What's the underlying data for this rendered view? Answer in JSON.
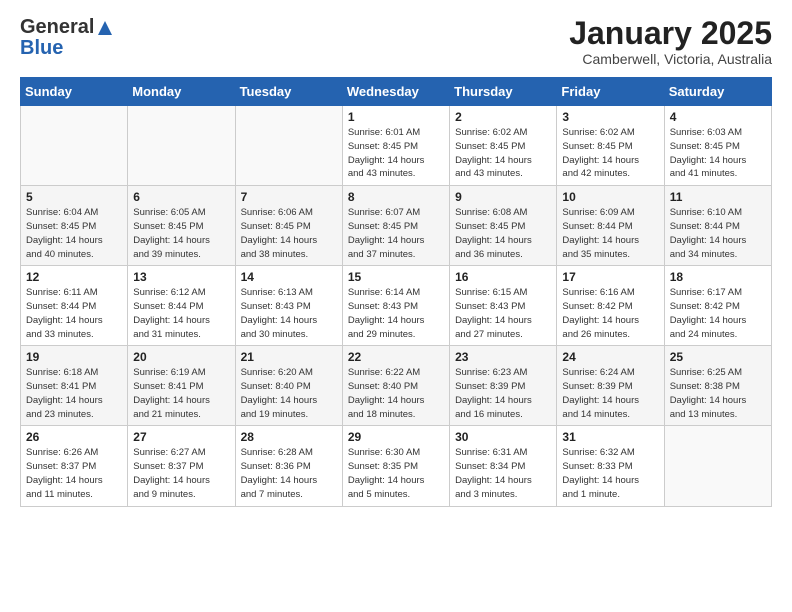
{
  "header": {
    "logo_general": "General",
    "logo_blue": "Blue",
    "month_title": "January 2025",
    "location": "Camberwell, Victoria, Australia"
  },
  "weekdays": [
    "Sunday",
    "Monday",
    "Tuesday",
    "Wednesday",
    "Thursday",
    "Friday",
    "Saturday"
  ],
  "weeks": [
    [
      {
        "num": "",
        "info": ""
      },
      {
        "num": "",
        "info": ""
      },
      {
        "num": "",
        "info": ""
      },
      {
        "num": "1",
        "info": "Sunrise: 6:01 AM\nSunset: 8:45 PM\nDaylight: 14 hours\nand 43 minutes."
      },
      {
        "num": "2",
        "info": "Sunrise: 6:02 AM\nSunset: 8:45 PM\nDaylight: 14 hours\nand 43 minutes."
      },
      {
        "num": "3",
        "info": "Sunrise: 6:02 AM\nSunset: 8:45 PM\nDaylight: 14 hours\nand 42 minutes."
      },
      {
        "num": "4",
        "info": "Sunrise: 6:03 AM\nSunset: 8:45 PM\nDaylight: 14 hours\nand 41 minutes."
      }
    ],
    [
      {
        "num": "5",
        "info": "Sunrise: 6:04 AM\nSunset: 8:45 PM\nDaylight: 14 hours\nand 40 minutes."
      },
      {
        "num": "6",
        "info": "Sunrise: 6:05 AM\nSunset: 8:45 PM\nDaylight: 14 hours\nand 39 minutes."
      },
      {
        "num": "7",
        "info": "Sunrise: 6:06 AM\nSunset: 8:45 PM\nDaylight: 14 hours\nand 38 minutes."
      },
      {
        "num": "8",
        "info": "Sunrise: 6:07 AM\nSunset: 8:45 PM\nDaylight: 14 hours\nand 37 minutes."
      },
      {
        "num": "9",
        "info": "Sunrise: 6:08 AM\nSunset: 8:45 PM\nDaylight: 14 hours\nand 36 minutes."
      },
      {
        "num": "10",
        "info": "Sunrise: 6:09 AM\nSunset: 8:44 PM\nDaylight: 14 hours\nand 35 minutes."
      },
      {
        "num": "11",
        "info": "Sunrise: 6:10 AM\nSunset: 8:44 PM\nDaylight: 14 hours\nand 34 minutes."
      }
    ],
    [
      {
        "num": "12",
        "info": "Sunrise: 6:11 AM\nSunset: 8:44 PM\nDaylight: 14 hours\nand 33 minutes."
      },
      {
        "num": "13",
        "info": "Sunrise: 6:12 AM\nSunset: 8:44 PM\nDaylight: 14 hours\nand 31 minutes."
      },
      {
        "num": "14",
        "info": "Sunrise: 6:13 AM\nSunset: 8:43 PM\nDaylight: 14 hours\nand 30 minutes."
      },
      {
        "num": "15",
        "info": "Sunrise: 6:14 AM\nSunset: 8:43 PM\nDaylight: 14 hours\nand 29 minutes."
      },
      {
        "num": "16",
        "info": "Sunrise: 6:15 AM\nSunset: 8:43 PM\nDaylight: 14 hours\nand 27 minutes."
      },
      {
        "num": "17",
        "info": "Sunrise: 6:16 AM\nSunset: 8:42 PM\nDaylight: 14 hours\nand 26 minutes."
      },
      {
        "num": "18",
        "info": "Sunrise: 6:17 AM\nSunset: 8:42 PM\nDaylight: 14 hours\nand 24 minutes."
      }
    ],
    [
      {
        "num": "19",
        "info": "Sunrise: 6:18 AM\nSunset: 8:41 PM\nDaylight: 14 hours\nand 23 minutes."
      },
      {
        "num": "20",
        "info": "Sunrise: 6:19 AM\nSunset: 8:41 PM\nDaylight: 14 hours\nand 21 minutes."
      },
      {
        "num": "21",
        "info": "Sunrise: 6:20 AM\nSunset: 8:40 PM\nDaylight: 14 hours\nand 19 minutes."
      },
      {
        "num": "22",
        "info": "Sunrise: 6:22 AM\nSunset: 8:40 PM\nDaylight: 14 hours\nand 18 minutes."
      },
      {
        "num": "23",
        "info": "Sunrise: 6:23 AM\nSunset: 8:39 PM\nDaylight: 14 hours\nand 16 minutes."
      },
      {
        "num": "24",
        "info": "Sunrise: 6:24 AM\nSunset: 8:39 PM\nDaylight: 14 hours\nand 14 minutes."
      },
      {
        "num": "25",
        "info": "Sunrise: 6:25 AM\nSunset: 8:38 PM\nDaylight: 14 hours\nand 13 minutes."
      }
    ],
    [
      {
        "num": "26",
        "info": "Sunrise: 6:26 AM\nSunset: 8:37 PM\nDaylight: 14 hours\nand 11 minutes."
      },
      {
        "num": "27",
        "info": "Sunrise: 6:27 AM\nSunset: 8:37 PM\nDaylight: 14 hours\nand 9 minutes."
      },
      {
        "num": "28",
        "info": "Sunrise: 6:28 AM\nSunset: 8:36 PM\nDaylight: 14 hours\nand 7 minutes."
      },
      {
        "num": "29",
        "info": "Sunrise: 6:30 AM\nSunset: 8:35 PM\nDaylight: 14 hours\nand 5 minutes."
      },
      {
        "num": "30",
        "info": "Sunrise: 6:31 AM\nSunset: 8:34 PM\nDaylight: 14 hours\nand 3 minutes."
      },
      {
        "num": "31",
        "info": "Sunrise: 6:32 AM\nSunset: 8:33 PM\nDaylight: 14 hours\nand 1 minute."
      },
      {
        "num": "",
        "info": ""
      }
    ]
  ]
}
